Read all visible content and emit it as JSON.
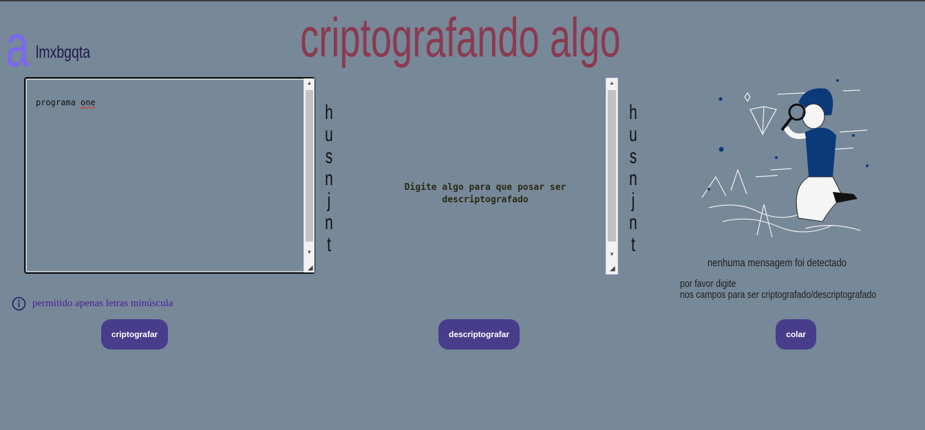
{
  "brand": {
    "mark": "a",
    "name": "lmxbgqta",
    "mark_color": "#7b68ee"
  },
  "title": "criptografando algo",
  "input": {
    "value_plain": "programa ",
    "value_flagged": "one"
  },
  "left_vertical": [
    "h",
    "u",
    "s",
    "n",
    "j",
    "n",
    "t"
  ],
  "right_vertical": [
    "h",
    "u",
    "s",
    "n",
    "j",
    "n",
    "t"
  ],
  "middle_message": {
    "line1": "Digite algo para que posar ser",
    "line2": "descriptografado"
  },
  "sidebar": {
    "illustration": "person-with-magnifier-and-diamond-illustration",
    "no_message": "nenhuma mensagem foi detectado",
    "please_line1": "por favor digite",
    "please_line2": "nos campos para ser criptografado/descriptografado"
  },
  "notice": {
    "icon": "info-icon",
    "text": "permitido apenas letras minúscula"
  },
  "buttons": {
    "encrypt": "criptografar",
    "decrypt": "descriptografar",
    "paste": "colar"
  },
  "colors": {
    "background": "#778899",
    "button": "#483d8b",
    "title": "#8b3a4f",
    "notice": "#4b1f9e"
  }
}
